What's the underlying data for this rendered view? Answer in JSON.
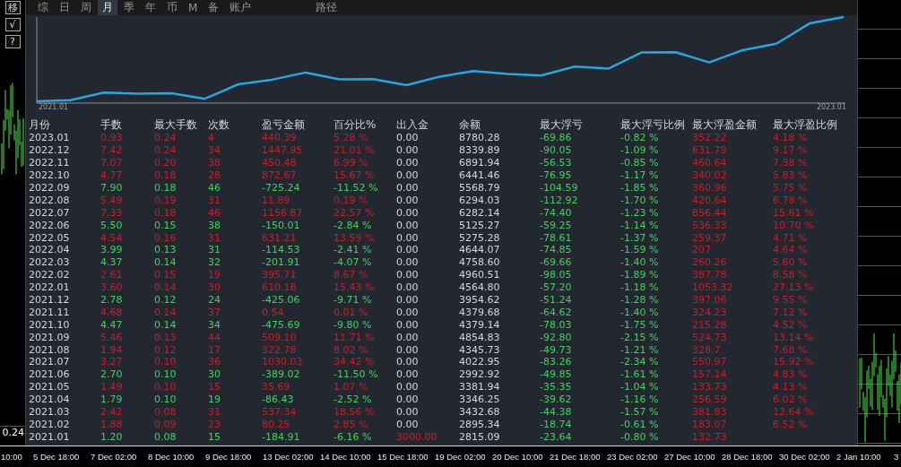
{
  "side_buttons": [
    "移",
    "√",
    "?"
  ],
  "tabs": [
    {
      "label": "综",
      "selected": false
    },
    {
      "label": "日",
      "selected": false
    },
    {
      "label": "周",
      "selected": false
    },
    {
      "label": "月",
      "selected": true
    },
    {
      "label": "季",
      "selected": false
    },
    {
      "label": "年",
      "selected": false
    },
    {
      "label": "币",
      "selected": false
    },
    {
      "label": "M",
      "selected": false
    },
    {
      "label": "备",
      "selected": false
    },
    {
      "label": "账户",
      "selected": false
    },
    {
      "label": "路径",
      "selected": false
    }
  ],
  "chart": {
    "start_label": "2021.01",
    "end_label": "2023.01"
  },
  "table": {
    "columns": [
      "月份",
      "手数",
      "最大手数",
      "次数",
      "盈亏金额",
      "百分比%",
      "出入金",
      "余额",
      "最大浮亏",
      "最大浮亏比例",
      "最大浮盈金额",
      "最大浮盈比例"
    ],
    "rows": [
      {
        "cells": [
          "2023.01",
          "0.93",
          "0.24",
          "4",
          "440.39",
          "5.28 %",
          "0.00",
          "8780.28",
          "-69.86",
          "-0.82 %",
          "352.22",
          "4.18 %"
        ],
        "loss": false,
        "deposit": false
      },
      {
        "cells": [
          "2022.12",
          "7.42",
          "0.24",
          "34",
          "1447.95",
          "21.01 %",
          "0.00",
          "8339.89",
          "-90.05",
          "-1.09 %",
          "631.79",
          "9.17 %"
        ],
        "loss": false,
        "deposit": false
      },
      {
        "cells": [
          "2022.11",
          "7.07",
          "0.20",
          "38",
          "450.48",
          "6.99 %",
          "0.00",
          "6891.94",
          "-56.53",
          "-0.85 %",
          "460.64",
          "7.38 %"
        ],
        "loss": false,
        "deposit": false
      },
      {
        "cells": [
          "2022.10",
          "4.77",
          "0.18",
          "28",
          "872.67",
          "15.67 %",
          "0.00",
          "6441.46",
          "-76.95",
          "-1.17 %",
          "340.02",
          "5.83 %"
        ],
        "loss": false,
        "deposit": false
      },
      {
        "cells": [
          "2022.09",
          "7.90",
          "0.18",
          "46",
          "-725.24",
          "-11.52 %",
          "0.00",
          "5568.79",
          "-104.59",
          "-1.85 %",
          "360.96",
          "5.75 %"
        ],
        "loss": true,
        "deposit": false
      },
      {
        "cells": [
          "2022.08",
          "5.49",
          "0.19",
          "31",
          "11.89",
          "0.19 %",
          "0.00",
          "6294.03",
          "-112.92",
          "-1.70 %",
          "420.64",
          "6.78 %"
        ],
        "loss": false,
        "deposit": false
      },
      {
        "cells": [
          "2022.07",
          "7.33",
          "0.18",
          "46",
          "1156.87",
          "22.57 %",
          "0.00",
          "6282.14",
          "-74.40",
          "-1.23 %",
          "856.44",
          "15.61 %"
        ],
        "loss": false,
        "deposit": false
      },
      {
        "cells": [
          "2022.06",
          "5.50",
          "0.15",
          "38",
          "-150.01",
          "-2.84 %",
          "0.00",
          "5125.27",
          "-59.25",
          "-1.14 %",
          "536.33",
          "10.70 %"
        ],
        "loss": true,
        "deposit": false
      },
      {
        "cells": [
          "2022.05",
          "4.54",
          "0.16",
          "31",
          "631.21",
          "13.59 %",
          "0.00",
          "5275.28",
          "-78.61",
          "-1.37 %",
          "259.37",
          "4.71 %"
        ],
        "loss": false,
        "deposit": false
      },
      {
        "cells": [
          "2022.04",
          "3.99",
          "0.13",
          "31",
          "-114.53",
          "-2.41 %",
          "0.00",
          "4644.07",
          "-74.85",
          "-1.59 %",
          "207",
          "4.64 %"
        ],
        "loss": true,
        "deposit": false
      },
      {
        "cells": [
          "2022.03",
          "4.37",
          "0.14",
          "32",
          "-201.91",
          "-4.07 %",
          "0.00",
          "4758.60",
          "-69.66",
          "-1.40 %",
          "260.26",
          "5.60 %"
        ],
        "loss": true,
        "deposit": false
      },
      {
        "cells": [
          "2022.02",
          "2.61",
          "0.15",
          "19",
          "395.71",
          "8.67 %",
          "0.00",
          "4960.51",
          "-98.05",
          "-1.89 %",
          "387.78",
          "8.58 %"
        ],
        "loss": false,
        "deposit": false
      },
      {
        "cells": [
          "2022.01",
          "3.60",
          "0.14",
          "30",
          "610.18",
          "15.43 %",
          "0.00",
          "4564.80",
          "-57.20",
          "-1.18 %",
          "1053.32",
          "27.13 %"
        ],
        "loss": false,
        "deposit": false
      },
      {
        "cells": [
          "2021.12",
          "2.78",
          "0.12",
          "24",
          "-425.06",
          "-9.71 %",
          "0.00",
          "3954.62",
          "-51.24",
          "-1.28 %",
          "397.06",
          "9.55 %"
        ],
        "loss": true,
        "deposit": false
      },
      {
        "cells": [
          "2021.11",
          "4.68",
          "0.14",
          "37",
          "0.54",
          "0.01 %",
          "0.00",
          "4379.68",
          "-64.62",
          "-1.40 %",
          "324.23",
          "7.12 %"
        ],
        "loss": false,
        "deposit": false
      },
      {
        "cells": [
          "2021.10",
          "4.47",
          "0.14",
          "34",
          "-475.69",
          "-9.80 %",
          "0.00",
          "4379.14",
          "-78.03",
          "-1.75 %",
          "215.28",
          "4.52 %"
        ],
        "loss": true,
        "deposit": false
      },
      {
        "cells": [
          "2021.09",
          "5.46",
          "0.13",
          "44",
          "509.10",
          "11.71 %",
          "0.00",
          "4854.83",
          "-92.80",
          "-2.15 %",
          "524.73",
          "13.14 %"
        ],
        "loss": false,
        "deposit": false
      },
      {
        "cells": [
          "2021.08",
          "1.94",
          "0.12",
          "17",
          "322.78",
          "8.02 %",
          "0.00",
          "4345.73",
          "-49.73",
          "-1.21 %",
          "328.7",
          "7.68 %"
        ],
        "loss": false,
        "deposit": false
      },
      {
        "cells": [
          "2021.07",
          "3.27",
          "0.10",
          "36",
          "1030.03",
          "34.42 %",
          "0.00",
          "4022.95",
          "-83.26",
          "-2.34 %",
          "550.97",
          "15.92 %"
        ],
        "loss": false,
        "deposit": false
      },
      {
        "cells": [
          "2021.06",
          "2.70",
          "0.10",
          "30",
          "-389.02",
          "-11.50 %",
          "0.00",
          "2992.92",
          "-49.85",
          "-1.61 %",
          "157.14",
          "4.83 %"
        ],
        "loss": true,
        "deposit": false
      },
      {
        "cells": [
          "2021.05",
          "1.49",
          "0.10",
          "15",
          "35.69",
          "1.07 %",
          "0.00",
          "3381.94",
          "-35.35",
          "-1.04 %",
          "133.73",
          "4.13 %"
        ],
        "loss": false,
        "deposit": false
      },
      {
        "cells": [
          "2021.04",
          "1.79",
          "0.10",
          "19",
          "-86.43",
          "-2.52 %",
          "0.00",
          "3346.25",
          "-39.62",
          "-1.16 %",
          "256.59",
          "6.02 %"
        ],
        "loss": true,
        "deposit": false
      },
      {
        "cells": [
          "2021.03",
          "2.42",
          "0.08",
          "31",
          "537.34",
          "18.56 %",
          "0.00",
          "3432.68",
          "-44.38",
          "-1.57 %",
          "381.83",
          "12.64 %"
        ],
        "loss": false,
        "deposit": false
      },
      {
        "cells": [
          "2021.02",
          "1.88",
          "0.09",
          "23",
          "80.25",
          "2.85 %",
          "0.00",
          "2895.34",
          "-18.74",
          "-0.61 %",
          "183.07",
          "6.52 %"
        ],
        "loss": false,
        "deposit": false
      },
      {
        "cells": [
          "2021.01",
          "1.20",
          "0.08",
          "15",
          "-184.91",
          "-6.16 %",
          "3000.00",
          "2815.09",
          "-23.64",
          "-0.80 %",
          "132.73"
        ],
        "loss": true,
        "deposit": true
      }
    ]
  },
  "price_label": "0.24",
  "time_axis": [
    "10:00",
    "5 Dec 18:00",
    "7 Dec 02:00",
    "8 Dec 10:00",
    "9 Dec 18:00",
    "13 Dec 02:00",
    "14 Dec 10:00",
    "15 Dec 18:00",
    "19 Dec 02:00",
    "20 Dec 10:00",
    "21 Dec 18:00",
    "23 Dec 02:00",
    "27 Dec 10:00",
    "28 Dec 18:00",
    "30 Dec 02:00",
    "2 Jan 10:00",
    "3"
  ]
}
